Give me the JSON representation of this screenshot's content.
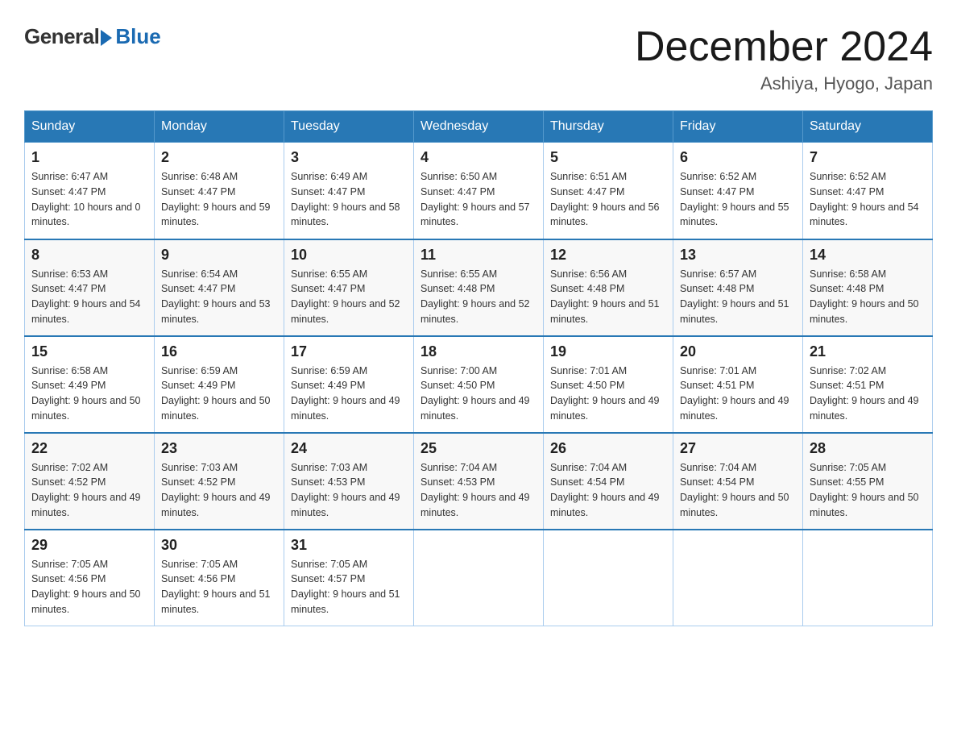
{
  "header": {
    "logo_general": "General",
    "logo_blue": "Blue",
    "month_title": "December 2024",
    "location": "Ashiya, Hyogo, Japan"
  },
  "days_of_week": [
    "Sunday",
    "Monday",
    "Tuesday",
    "Wednesday",
    "Thursday",
    "Friday",
    "Saturday"
  ],
  "weeks": [
    [
      {
        "day": "1",
        "sunrise": "6:47 AM",
        "sunset": "4:47 PM",
        "daylight": "10 hours and 0 minutes."
      },
      {
        "day": "2",
        "sunrise": "6:48 AM",
        "sunset": "4:47 PM",
        "daylight": "9 hours and 59 minutes."
      },
      {
        "day": "3",
        "sunrise": "6:49 AM",
        "sunset": "4:47 PM",
        "daylight": "9 hours and 58 minutes."
      },
      {
        "day": "4",
        "sunrise": "6:50 AM",
        "sunset": "4:47 PM",
        "daylight": "9 hours and 57 minutes."
      },
      {
        "day": "5",
        "sunrise": "6:51 AM",
        "sunset": "4:47 PM",
        "daylight": "9 hours and 56 minutes."
      },
      {
        "day": "6",
        "sunrise": "6:52 AM",
        "sunset": "4:47 PM",
        "daylight": "9 hours and 55 minutes."
      },
      {
        "day": "7",
        "sunrise": "6:52 AM",
        "sunset": "4:47 PM",
        "daylight": "9 hours and 54 minutes."
      }
    ],
    [
      {
        "day": "8",
        "sunrise": "6:53 AM",
        "sunset": "4:47 PM",
        "daylight": "9 hours and 54 minutes."
      },
      {
        "day": "9",
        "sunrise": "6:54 AM",
        "sunset": "4:47 PM",
        "daylight": "9 hours and 53 minutes."
      },
      {
        "day": "10",
        "sunrise": "6:55 AM",
        "sunset": "4:47 PM",
        "daylight": "9 hours and 52 minutes."
      },
      {
        "day": "11",
        "sunrise": "6:55 AM",
        "sunset": "4:48 PM",
        "daylight": "9 hours and 52 minutes."
      },
      {
        "day": "12",
        "sunrise": "6:56 AM",
        "sunset": "4:48 PM",
        "daylight": "9 hours and 51 minutes."
      },
      {
        "day": "13",
        "sunrise": "6:57 AM",
        "sunset": "4:48 PM",
        "daylight": "9 hours and 51 minutes."
      },
      {
        "day": "14",
        "sunrise": "6:58 AM",
        "sunset": "4:48 PM",
        "daylight": "9 hours and 50 minutes."
      }
    ],
    [
      {
        "day": "15",
        "sunrise": "6:58 AM",
        "sunset": "4:49 PM",
        "daylight": "9 hours and 50 minutes."
      },
      {
        "day": "16",
        "sunrise": "6:59 AM",
        "sunset": "4:49 PM",
        "daylight": "9 hours and 50 minutes."
      },
      {
        "day": "17",
        "sunrise": "6:59 AM",
        "sunset": "4:49 PM",
        "daylight": "9 hours and 49 minutes."
      },
      {
        "day": "18",
        "sunrise": "7:00 AM",
        "sunset": "4:50 PM",
        "daylight": "9 hours and 49 minutes."
      },
      {
        "day": "19",
        "sunrise": "7:01 AM",
        "sunset": "4:50 PM",
        "daylight": "9 hours and 49 minutes."
      },
      {
        "day": "20",
        "sunrise": "7:01 AM",
        "sunset": "4:51 PM",
        "daylight": "9 hours and 49 minutes."
      },
      {
        "day": "21",
        "sunrise": "7:02 AM",
        "sunset": "4:51 PM",
        "daylight": "9 hours and 49 minutes."
      }
    ],
    [
      {
        "day": "22",
        "sunrise": "7:02 AM",
        "sunset": "4:52 PM",
        "daylight": "9 hours and 49 minutes."
      },
      {
        "day": "23",
        "sunrise": "7:03 AM",
        "sunset": "4:52 PM",
        "daylight": "9 hours and 49 minutes."
      },
      {
        "day": "24",
        "sunrise": "7:03 AM",
        "sunset": "4:53 PM",
        "daylight": "9 hours and 49 minutes."
      },
      {
        "day": "25",
        "sunrise": "7:04 AM",
        "sunset": "4:53 PM",
        "daylight": "9 hours and 49 minutes."
      },
      {
        "day": "26",
        "sunrise": "7:04 AM",
        "sunset": "4:54 PM",
        "daylight": "9 hours and 49 minutes."
      },
      {
        "day": "27",
        "sunrise": "7:04 AM",
        "sunset": "4:54 PM",
        "daylight": "9 hours and 50 minutes."
      },
      {
        "day": "28",
        "sunrise": "7:05 AM",
        "sunset": "4:55 PM",
        "daylight": "9 hours and 50 minutes."
      }
    ],
    [
      {
        "day": "29",
        "sunrise": "7:05 AM",
        "sunset": "4:56 PM",
        "daylight": "9 hours and 50 minutes."
      },
      {
        "day": "30",
        "sunrise": "7:05 AM",
        "sunset": "4:56 PM",
        "daylight": "9 hours and 51 minutes."
      },
      {
        "day": "31",
        "sunrise": "7:05 AM",
        "sunset": "4:57 PM",
        "daylight": "9 hours and 51 minutes."
      },
      null,
      null,
      null,
      null
    ]
  ]
}
